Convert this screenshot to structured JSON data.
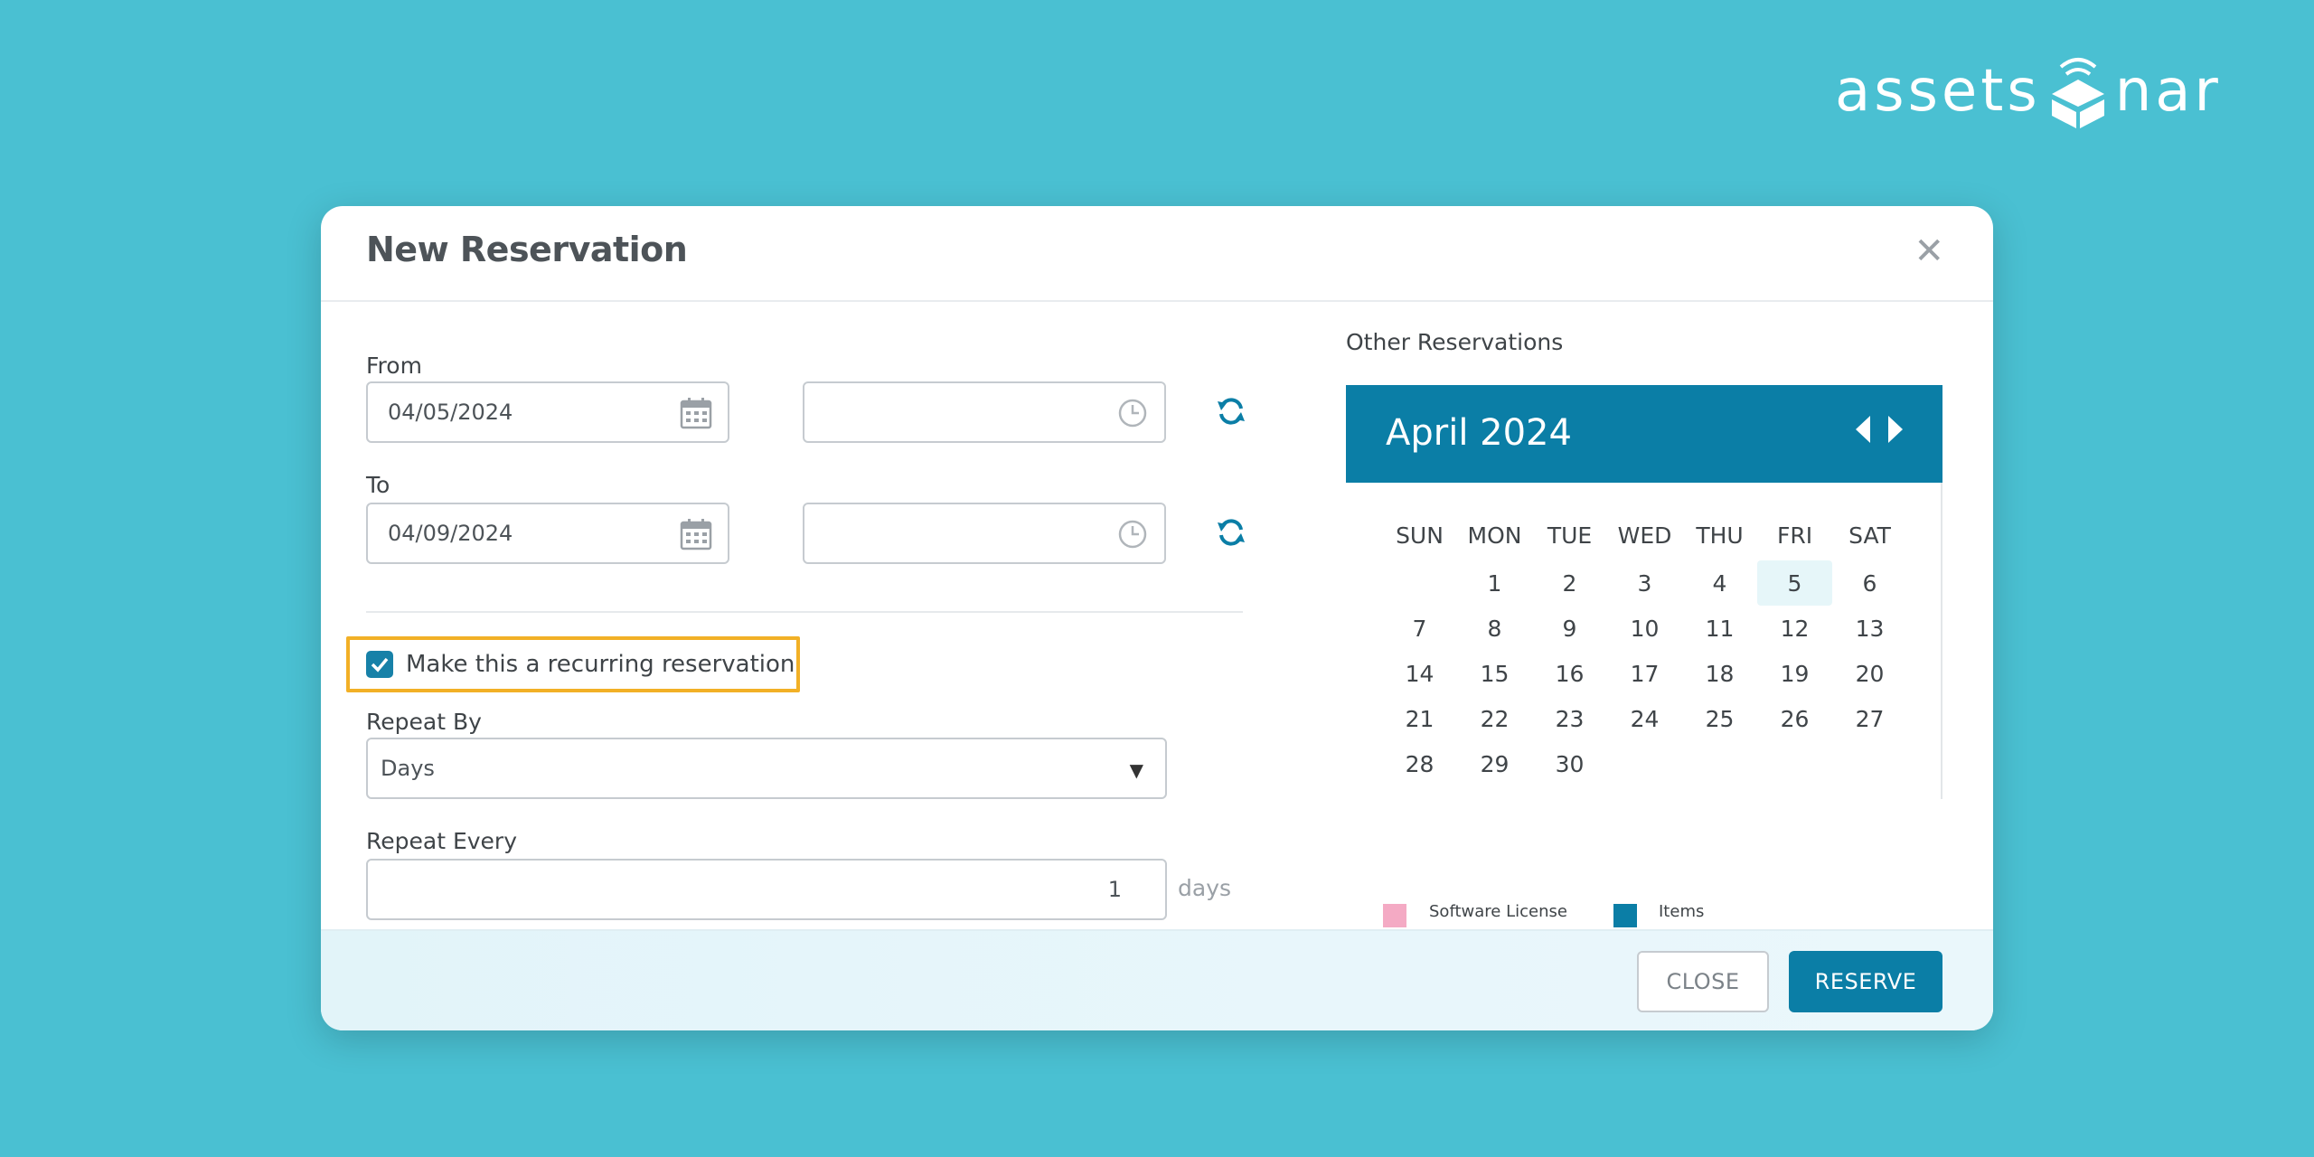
{
  "brand": {
    "logo_text_left": "assets",
    "logo_text_right": "nar",
    "background_color": "#4ac0d2"
  },
  "dialog": {
    "title": "New Reservation",
    "close_icon": "close-icon"
  },
  "form": {
    "from_label": "From",
    "from_date": "04/05/2024",
    "from_time": "",
    "to_label": "To",
    "to_date": "04/09/2024",
    "to_time": "",
    "recurring_label": "Make this a recurring reservation",
    "recurring_checked": true,
    "repeat_by_label": "Repeat By",
    "repeat_by_value": "Days",
    "repeat_every_label": "Repeat Every",
    "repeat_every_value": "1",
    "repeat_every_unit": "days"
  },
  "calendar": {
    "section_title": "Other Reservations",
    "month_label": "April 2024",
    "weekdays": [
      "SUN",
      "MON",
      "TUE",
      "WED",
      "THU",
      "FRI",
      "SAT"
    ],
    "first_weekday_offset": 1,
    "days": [
      "1",
      "2",
      "3",
      "4",
      "5",
      "6",
      "7",
      "8",
      "9",
      "10",
      "11",
      "12",
      "13",
      "14",
      "15",
      "16",
      "17",
      "18",
      "19",
      "20",
      "21",
      "22",
      "23",
      "24",
      "25",
      "26",
      "27",
      "28",
      "29",
      "30"
    ],
    "highlighted_day": "5",
    "accent_color": "#0b7ea6"
  },
  "legend": {
    "software_license_label": "Software License",
    "software_license_color": "#f4aac4",
    "items_label": "Items",
    "items_color": "#0b7ea6"
  },
  "footer": {
    "close_label": "CLOSE",
    "reserve_label": "RESERVE"
  }
}
